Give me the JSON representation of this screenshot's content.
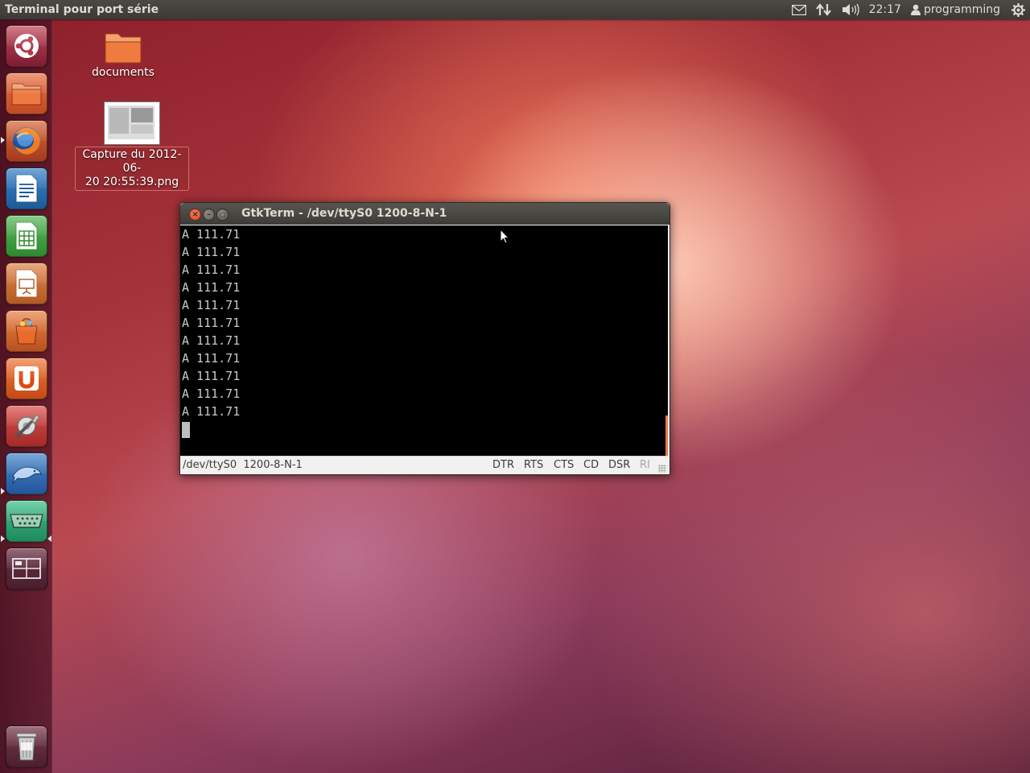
{
  "top_panel": {
    "app_title": "Terminal pour port série",
    "clock": "22:17",
    "user_name": "programming",
    "icons": [
      "mail-icon",
      "network-icon",
      "volume-icon",
      "user-icon",
      "system-gear-icon"
    ]
  },
  "launcher": {
    "items": [
      {
        "name": "Dash home",
        "icon": "ubuntu-logo-icon"
      },
      {
        "name": "Home Folder",
        "icon": "folder-icon"
      },
      {
        "name": "Firefox",
        "icon": "firefox-icon"
      },
      {
        "name": "LibreOffice Writer",
        "icon": "writer-icon"
      },
      {
        "name": "LibreOffice Calc",
        "icon": "calc-icon"
      },
      {
        "name": "LibreOffice Impress",
        "icon": "impress-icon"
      },
      {
        "name": "Software Center",
        "icon": "software-center-icon"
      },
      {
        "name": "Ubuntu One",
        "icon": "ubuntu-one-icon"
      },
      {
        "name": "System Settings",
        "icon": "settings-icon"
      },
      {
        "name": "Dolphin",
        "icon": "dolphin-icon"
      },
      {
        "name": "GtkTerm",
        "icon": "serial-port-icon"
      },
      {
        "name": "Workspace Switcher",
        "icon": "workspace-switcher-icon"
      },
      {
        "name": "Trash",
        "icon": "trash-icon"
      }
    ]
  },
  "desktop": {
    "icons": [
      {
        "label": "documents",
        "icon": "folder-icon"
      },
      {
        "label_line1": "Capture du 2012-06-",
        "label_line2": "20 20:55:39.png",
        "icon": "image-thumbnail-icon"
      }
    ]
  },
  "window": {
    "title": "GtkTerm - /dev/ttyS0  1200-8-N-1",
    "terminal_lines": [
      "A 111.71",
      "A 111.71",
      "A 111.71",
      "A 111.71",
      "A 111.71",
      "A 111.71",
      "A 111.71",
      "A 111.71",
      "A 111.71",
      "A 111.71",
      "A 111.71"
    ],
    "status": {
      "port": "/dev/ttyS0  1200-8-N-1",
      "signals": [
        {
          "label": "DTR",
          "active": true
        },
        {
          "label": "RTS",
          "active": true
        },
        {
          "label": "CTS",
          "active": true
        },
        {
          "label": "CD",
          "active": true
        },
        {
          "label": "DSR",
          "active": true
        },
        {
          "label": "RI",
          "active": false
        }
      ]
    }
  },
  "colors": {
    "panel": "#3c3b37",
    "close_button": "#e25a2d",
    "terminal_bg": "#000000",
    "terminal_fg": "#c8c8c8",
    "accent_orange": "#f07746"
  }
}
